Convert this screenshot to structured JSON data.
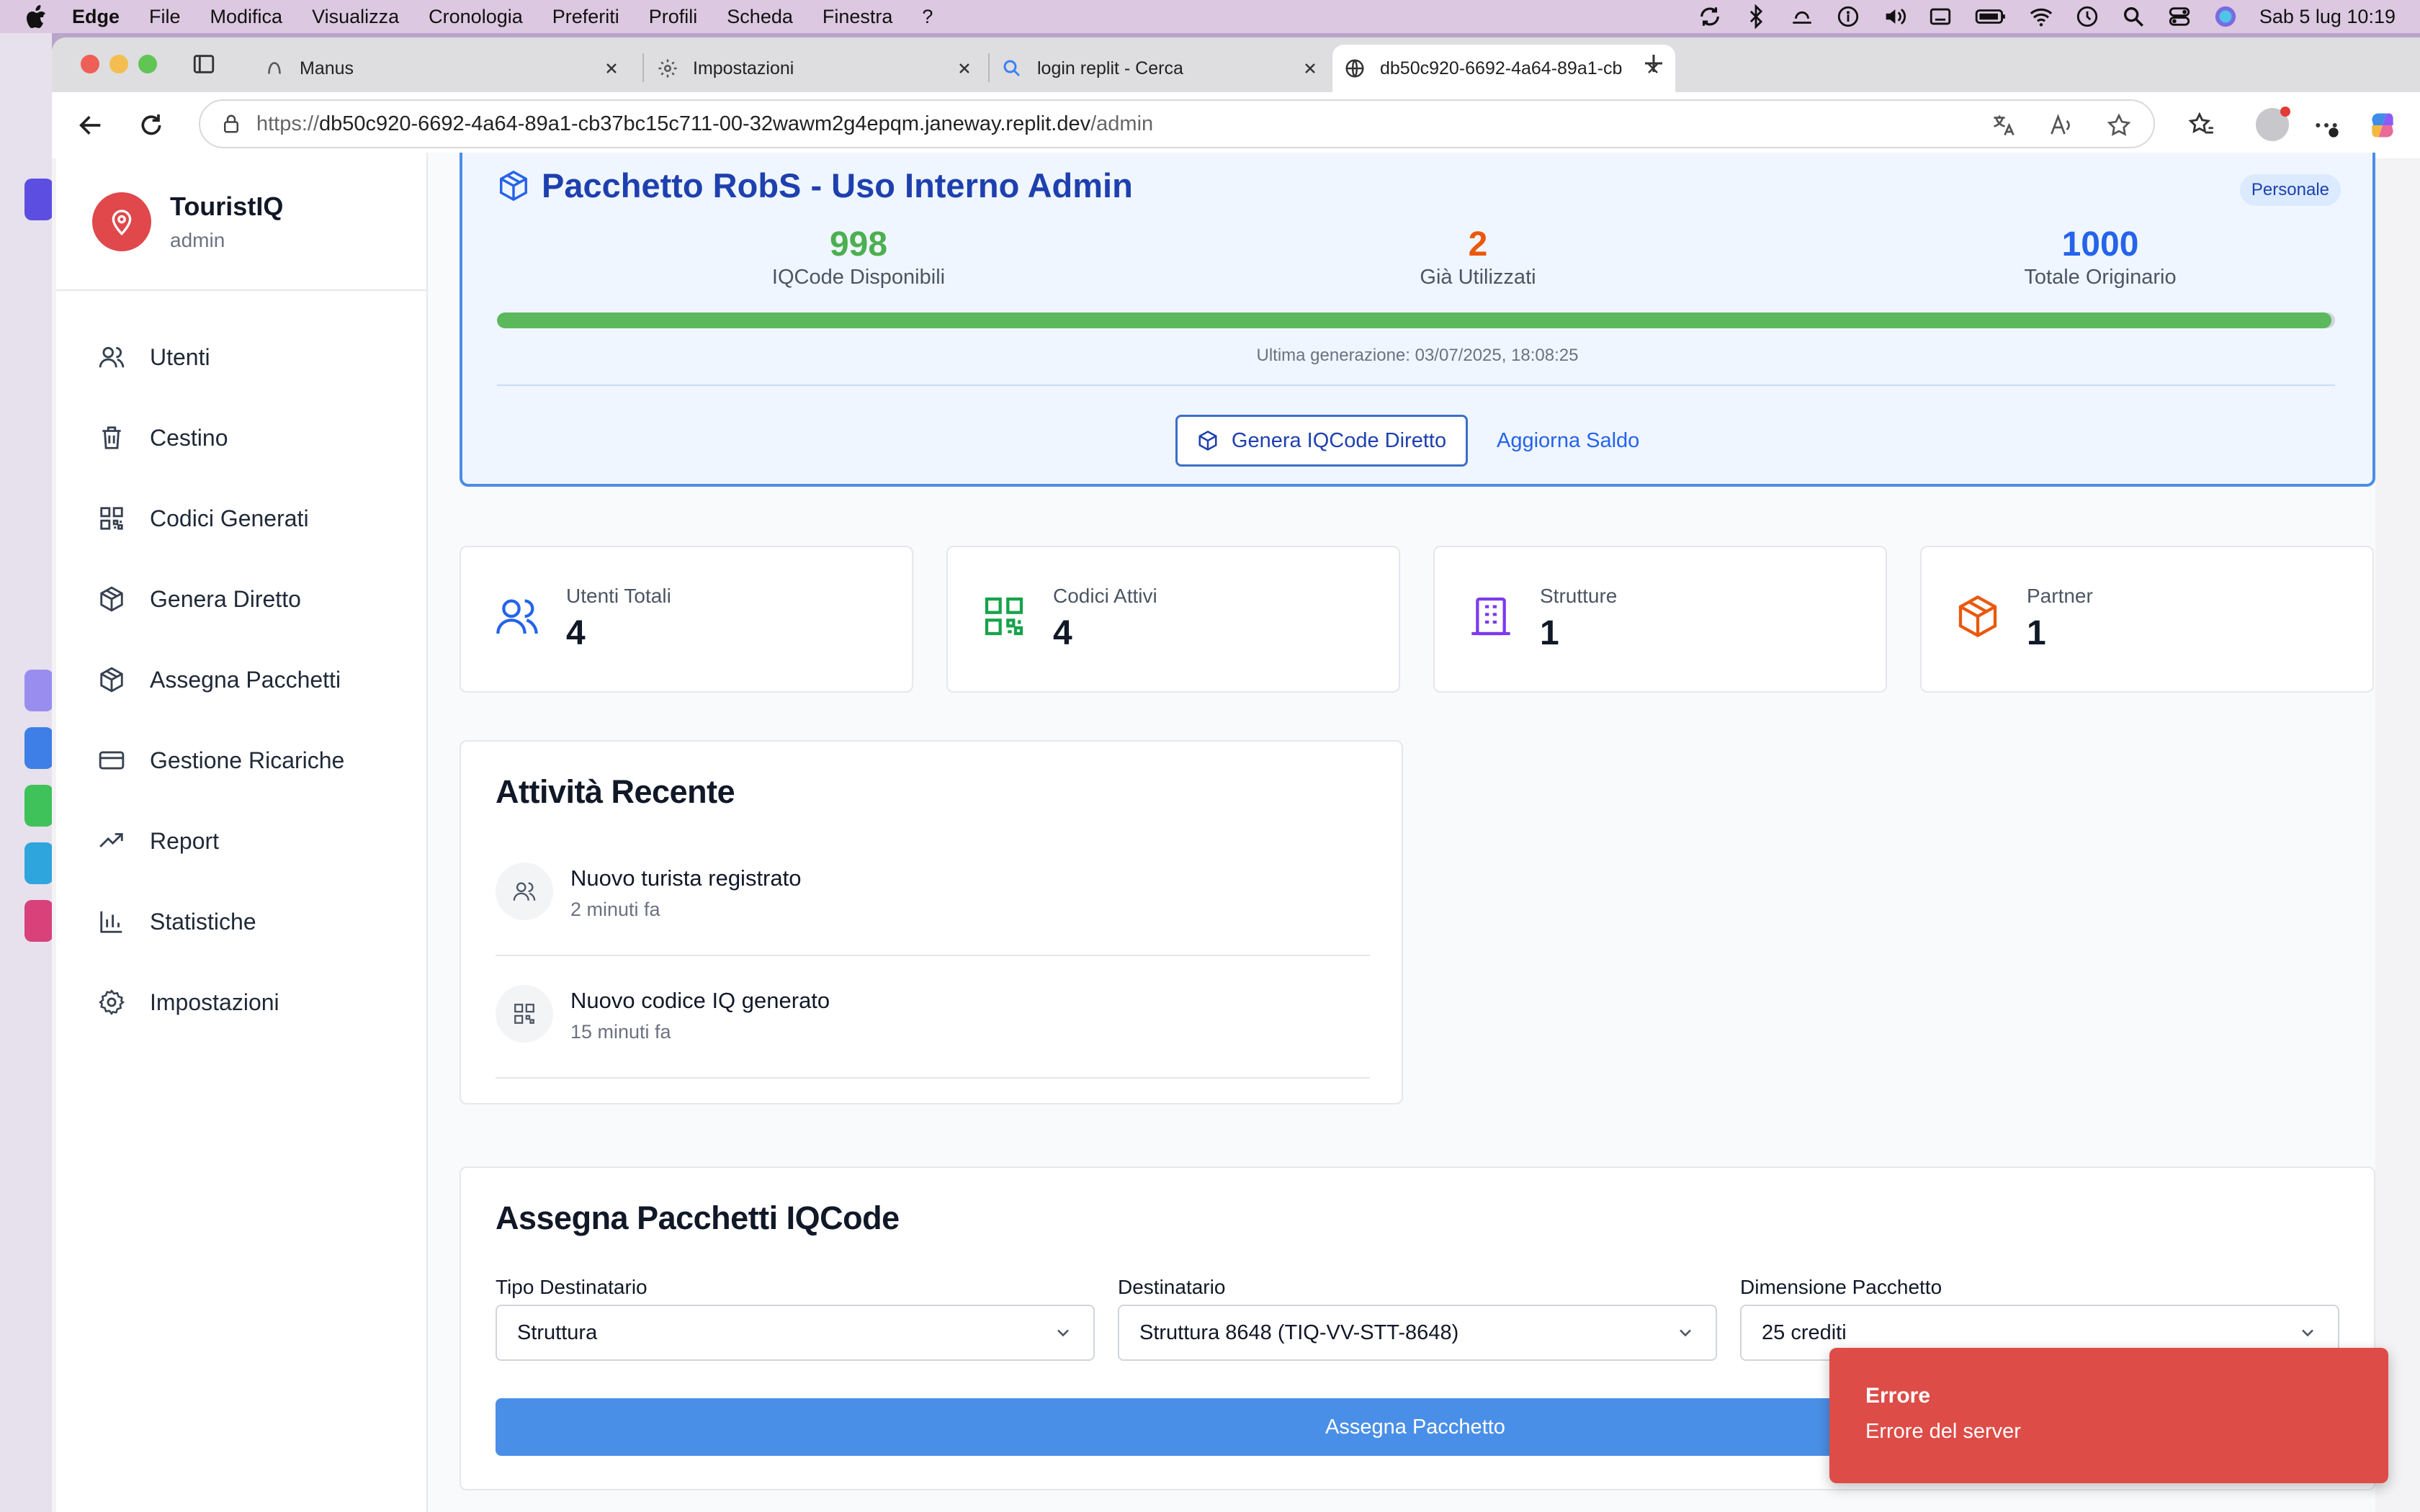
{
  "menubar": {
    "app": "Edge",
    "items": [
      "File",
      "Modifica",
      "Visualizza",
      "Cronologia",
      "Preferiti",
      "Profili",
      "Scheda",
      "Finestra",
      "?"
    ],
    "clock": "Sab 5 lug  10:19"
  },
  "browser": {
    "tabs": [
      {
        "label": "Manus"
      },
      {
        "label": "Impostazioni"
      },
      {
        "label": "login replit - Cerca"
      },
      {
        "label": "db50c920-6692-4a64-89a1-cb"
      }
    ],
    "url_prefix": "https://",
    "url_host": "db50c920-6692-4a64-89a1-cb37bc15c711-00-32wawm2g4epqm.janeway.replit.dev",
    "url_path": "/admin"
  },
  "sidebar": {
    "brand_name": "TouristIQ",
    "role": "admin",
    "items": [
      {
        "label": "Utenti",
        "icon": "users-icon"
      },
      {
        "label": "Cestino",
        "icon": "trash-icon"
      },
      {
        "label": "Codici Generati",
        "icon": "qr-code-icon"
      },
      {
        "label": "Genera Diretto",
        "icon": "package-icon"
      },
      {
        "label": "Assegna Pacchetti",
        "icon": "package-icon"
      },
      {
        "label": "Gestione Ricariche",
        "icon": "credit-card-icon"
      },
      {
        "label": "Report",
        "icon": "trending-up-icon"
      },
      {
        "label": "Statistiche",
        "icon": "bar-chart-icon"
      },
      {
        "label": "Impostazioni",
        "icon": "settings-icon"
      }
    ]
  },
  "package": {
    "title": "Pacchetto RobS - Uso Interno Admin",
    "badge": "Personale",
    "available_value": "998",
    "available_label": "IQCode Disponibili",
    "used_value": "2",
    "used_label": "Già Utilizzati",
    "total_value": "1000",
    "total_label": "Totale Originario",
    "progress_fraction": 0.998,
    "last_generation": "Ultima generazione: 03/07/2025, 18:08:25",
    "generate_button": "Genera IQCode Diretto",
    "refresh_link": "Aggiorna Saldo"
  },
  "stats": [
    {
      "label": "Utenti Totali",
      "value": "4",
      "icon": "users-icon",
      "color": "#2563eb"
    },
    {
      "label": "Codici Attivi",
      "value": "4",
      "icon": "qr-code-icon",
      "color": "#16a34a"
    },
    {
      "label": "Strutture",
      "value": "1",
      "icon": "building-icon",
      "color": "#7c3aed"
    },
    {
      "label": "Partner",
      "value": "1",
      "icon": "package-icon",
      "color": "#ea580c"
    }
  ],
  "activity": {
    "title": "Attività Recente",
    "items": [
      {
        "title": "Nuovo turista registrato",
        "time": "2 minuti fa",
        "icon": "users-icon"
      },
      {
        "title": "Nuovo codice IQ generato",
        "time": "15 minuti fa",
        "icon": "qr-code-icon"
      }
    ]
  },
  "assign": {
    "title": "Assegna Pacchetti IQCode",
    "recipient_type_label": "Tipo Destinatario",
    "recipient_type_value": "Struttura",
    "recipient_label": "Destinatario",
    "recipient_value": "Struttura 8648 (TIQ-VV-STT-8648)",
    "size_label": "Dimensione Pacchetto",
    "size_value": "25 crediti",
    "submit": "Assegna Pacchetto"
  },
  "toast": {
    "title": "Errore",
    "message": "Errore del server"
  },
  "colors": {
    "accent_blue": "#4a8fe7",
    "brand_red": "#e0484b",
    "success_green": "#16a34a",
    "used_orange": "#ea580c",
    "error_red": "#de4c47"
  }
}
